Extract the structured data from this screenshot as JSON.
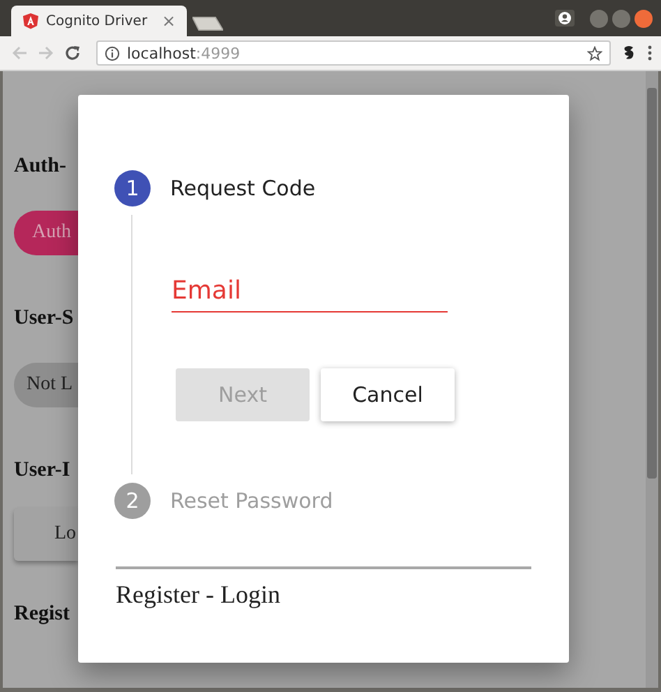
{
  "browser": {
    "tab": {
      "title": "Cognito Driver",
      "close": "×"
    },
    "address": {
      "host": "localhost",
      "port": ":4999"
    }
  },
  "page": {
    "sections": [
      {
        "heading": "Auth-",
        "control": {
          "kind": "pill",
          "label": "Auth"
        }
      },
      {
        "heading": "User-S",
        "control": {
          "kind": "chip",
          "label": "Not L"
        }
      },
      {
        "heading": "User-I",
        "control": {
          "kind": "raised",
          "label": "Lo"
        }
      },
      {
        "heading": "Regist"
      }
    ]
  },
  "dialog": {
    "steps": [
      {
        "number": "1",
        "label": "Request Code",
        "selected": true
      },
      {
        "number": "2",
        "label": "Reset Password",
        "selected": false
      }
    ],
    "email": {
      "placeholder": "Email"
    },
    "buttons": [
      {
        "label": "Next",
        "disabled": true
      },
      {
        "label": "Cancel",
        "disabled": false
      }
    ],
    "footer_link": "Register - Login"
  }
}
